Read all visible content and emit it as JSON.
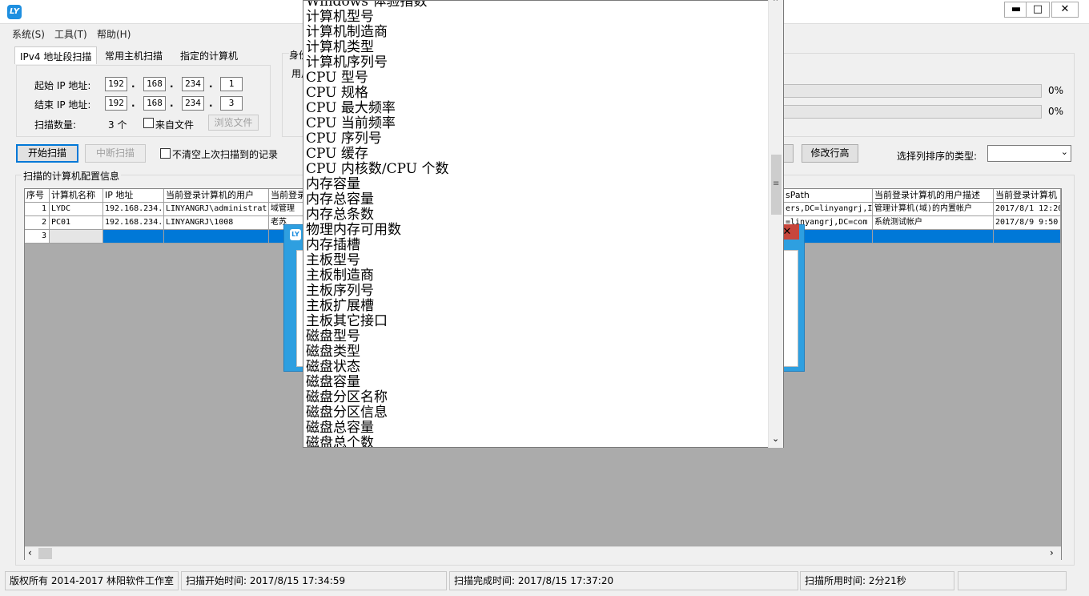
{
  "window": {
    "icon_label": "LY",
    "min_label": "▬",
    "max_label": "□",
    "close_label": "✕"
  },
  "menu": [
    "系统(S)",
    "工具(T)",
    "帮助(H)"
  ],
  "tabs": [
    "IPv4 地址段扫描",
    "常用主机扫描",
    "指定的计算机"
  ],
  "scan": {
    "start_ip_label": "起始 IP 地址:",
    "end_ip_label": "结束 IP 地址:",
    "start_ip": [
      "192",
      "168",
      "234",
      "1"
    ],
    "end_ip": [
      "192",
      "168",
      "234",
      "3"
    ],
    "count_label": "扫描数量:",
    "count_value": "3 个",
    "from_file_label": "来自文件",
    "browse_label": "浏览文件"
  },
  "auth": {
    "title_partial": "身份",
    "user_partial": "用户"
  },
  "progress": [
    {
      "value": "0%",
      "fraction": 0.0
    },
    {
      "value": "0%",
      "fraction": 0.0
    }
  ],
  "actions": {
    "start_label": "开始扫描",
    "stop_label": "中断扫描",
    "keep_label": "不清空上次扫描到的记录",
    "row_height_label": "修改行高",
    "sort_type_label": "选择列排序的类型:",
    "sort_type_value": ""
  },
  "grid": {
    "title": "扫描的计算机配置信息",
    "headers": [
      "序号",
      "计算机名称",
      "IP 地址",
      "当前登录计算机的用户",
      "当前登录",
      "sPath",
      "当前登录计算机的用户描述",
      "当前登录计算机"
    ],
    "rows": [
      [
        "1",
        "LYDC",
        "192.168.234.",
        "LINYANGRJ\\administrat",
        "域管理",
        "ers,DC=linyangrj,I",
        "管理计算机(域)的内置帐户",
        "2017/8/1 12:20"
      ],
      [
        "2",
        "PC01",
        "192.168.234.",
        "LINYANGRJ\\1008",
        "老苏",
        "=linyangrj,DC=com",
        "系统测试帐户",
        "2017/8/9 9:50"
      ],
      [
        "3",
        "",
        "",
        "",
        "",
        "",
        "",
        ""
      ]
    ]
  },
  "dropdown": {
    "items": [
      "Windows 体验指数",
      "计算机型号",
      "计算机制造商",
      "计算机类型",
      "计算机序列号",
      "CPU 型号",
      "CPU 规格",
      "CPU 最大频率",
      "CPU 当前频率",
      "CPU 序列号",
      "CPU 缓存",
      "CPU 内核数/CPU 个数",
      "内存容量",
      "内存总容量",
      "内存总条数",
      "物理内存可用数",
      "内存插槽",
      "主板型号",
      "主板制造商",
      "主板序列号",
      "主板扩展槽",
      "主板其它接口",
      "磁盘型号",
      "磁盘类型",
      "磁盘状态",
      "磁盘容量",
      "磁盘分区名称",
      "磁盘分区信息",
      "磁盘总容量",
      "磁盘总个数"
    ]
  },
  "status": {
    "copyright": "版权所有 2014-2017 林阳软件工作室",
    "start_time": "扫描开始时间: 2017/8/15 17:34:59",
    "end_time": "扫描完成时间: 2017/8/15 17:37:20",
    "elapsed": "扫描所用时间: 2分21秒"
  },
  "colors": {
    "accent": "#0078d7",
    "dialog_blue": "#2e9fe0",
    "close_red": "#c7463c"
  }
}
